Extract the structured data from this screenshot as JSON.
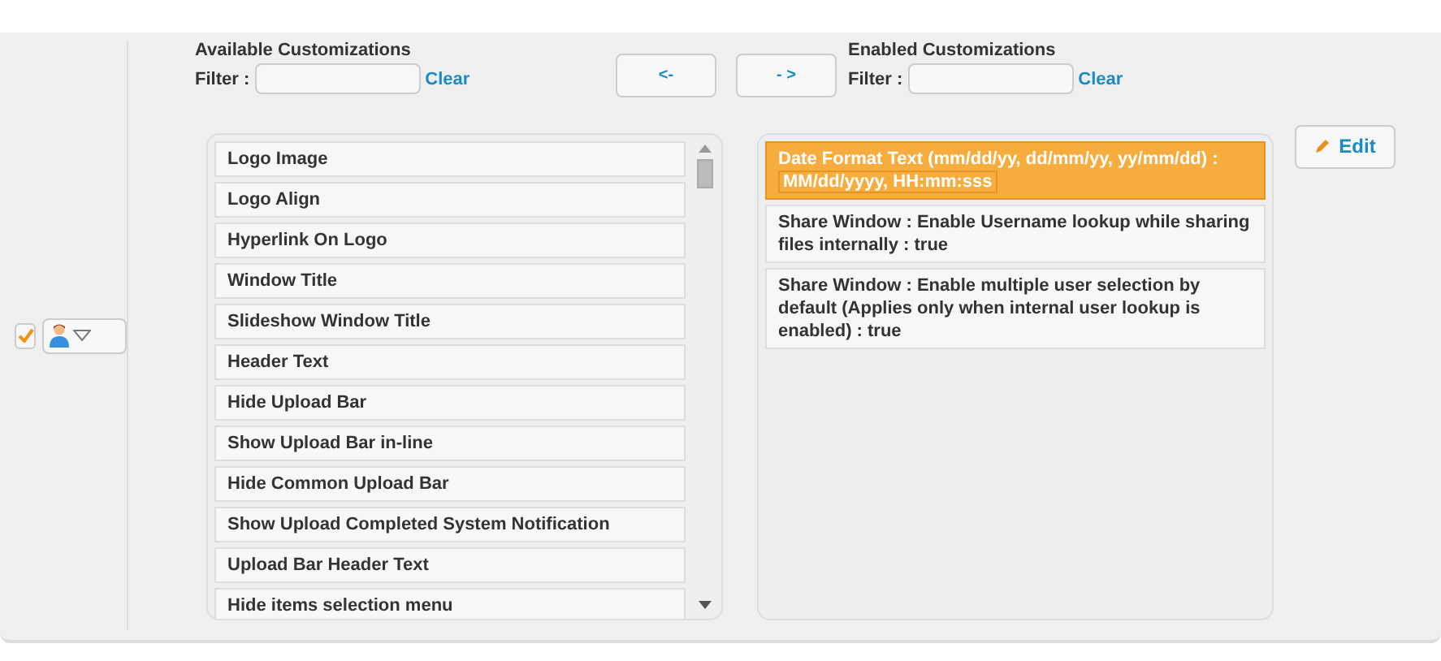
{
  "row_checkbox": {
    "checked": true
  },
  "user_menu": {
    "expanded": false
  },
  "available": {
    "title": "Available Customizations",
    "filter_label": "Filter :",
    "clear": "Clear",
    "items": [
      {
        "label": "Logo Image",
        "selected": false
      },
      {
        "label": "Logo Align",
        "selected": false
      },
      {
        "label": "Hyperlink On Logo",
        "selected": false
      },
      {
        "label": "Window Title",
        "selected": false
      },
      {
        "label": "Slideshow Window Title",
        "selected": false
      },
      {
        "label": "Header Text",
        "selected": false
      },
      {
        "label": "Hide Upload Bar",
        "selected": false
      },
      {
        "label": "Show Upload Bar in-line",
        "selected": false
      },
      {
        "label": "Hide Common Upload Bar",
        "selected": false
      },
      {
        "label": "Show Upload Completed System Notification",
        "selected": false
      },
      {
        "label": "Upload Bar Header Text",
        "selected": false
      },
      {
        "label": "Hide items selection menu",
        "selected": false
      }
    ]
  },
  "move_buttons": {
    "remove": "<-",
    "add": "- >"
  },
  "enabled": {
    "title": "Enabled Customizations",
    "filter_label": "Filter :",
    "clear": "Clear",
    "items": [
      {
        "label": "Date Format Text (mm/dd/yy, dd/mm/yy, yy/mm/dd) :",
        "value": "MM/dd/yyyy, HH:mm:sss",
        "selected": true
      },
      {
        "label": "Share Window : Enable Username lookup while sharing files internally : true",
        "selected": false
      },
      {
        "label": "Share Window : Enable multiple user selection by default (Applies only when internal user lookup is enabled) : true",
        "selected": false
      }
    ]
  },
  "edit_button": "Edit"
}
